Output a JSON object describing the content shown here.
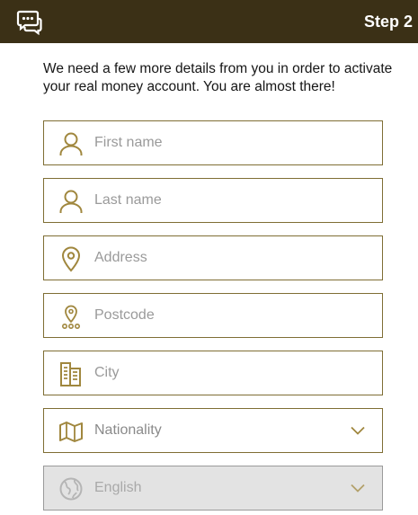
{
  "header": {
    "step": "Step 2",
    "icon": "chat-bubbles-icon",
    "background": "#3b3016"
  },
  "intro": "We need a few more details from you in order to activate your real money account. You are almost there!",
  "colors": {
    "accent": "#a0873e",
    "border": "#7f6e34",
    "disabled_bg": "#e3e3e3"
  },
  "form": {
    "first_name": {
      "placeholder": "First name",
      "value": "",
      "icon": "person-icon"
    },
    "last_name": {
      "placeholder": "Last name",
      "value": "",
      "icon": "person-icon"
    },
    "address": {
      "placeholder": "Address",
      "value": "",
      "icon": "map-pin-icon"
    },
    "postcode": {
      "placeholder": "Postcode",
      "value": "",
      "icon": "pin-dots-icon"
    },
    "city": {
      "placeholder": "City",
      "value": "",
      "icon": "buildings-icon"
    },
    "nationality": {
      "label": "Nationality",
      "icon": "map-icon"
    },
    "language": {
      "label": "English",
      "icon": "globe-icon",
      "disabled": true
    }
  }
}
